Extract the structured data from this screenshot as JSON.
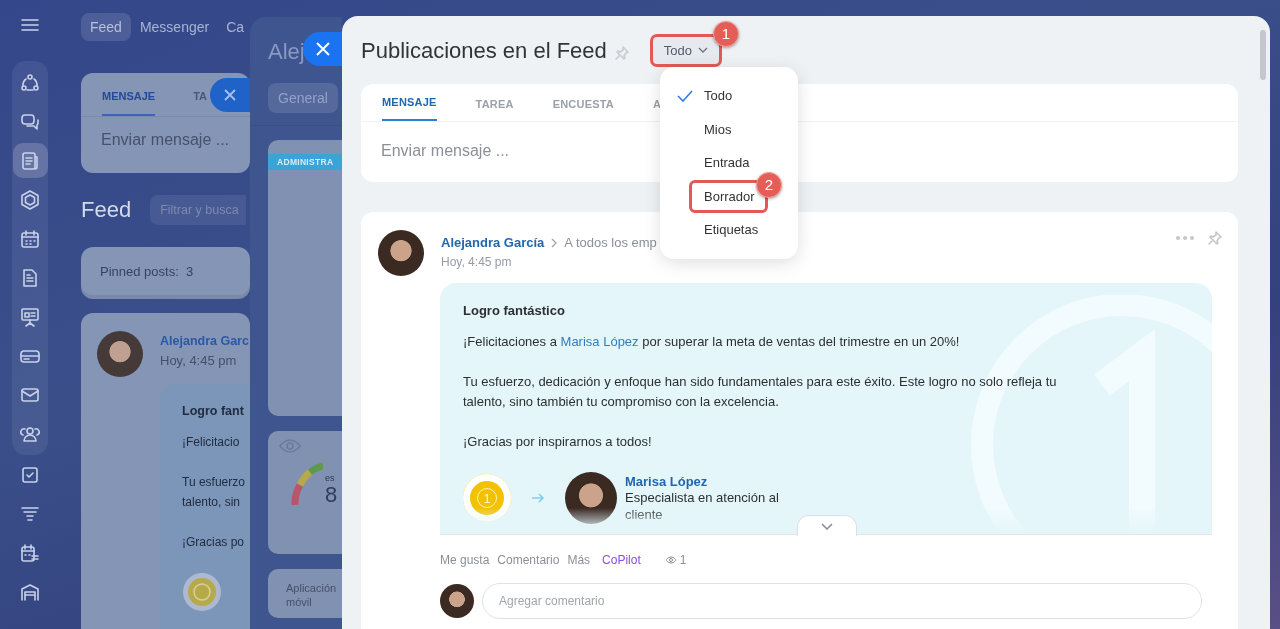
{
  "sidebar": {
    "items": [
      {
        "selected": false
      },
      {
        "selected": false
      },
      {
        "selected": true
      },
      {
        "selected": false
      },
      {
        "selected": false
      },
      {
        "selected": false
      },
      {
        "selected": false
      },
      {
        "selected": false
      },
      {
        "selected": false
      },
      {
        "selected": false
      },
      {
        "selected": false
      },
      {
        "selected": false
      },
      {
        "selected": false
      },
      {
        "selected": false
      }
    ]
  },
  "background": {
    "top_tabs": [
      {
        "label": "Feed",
        "selected": true
      },
      {
        "label": "Messenger",
        "selected": false
      },
      {
        "label": "Ca",
        "selected": false
      }
    ],
    "composer": {
      "tabs": [
        {
          "label": "MENSAJE",
          "selected": true
        },
        {
          "label": "TA",
          "selected": false
        }
      ],
      "placeholder": "Enviar mensaje ..."
    },
    "feed_title": "Feed",
    "filter_placeholder": "Filtrar y busca",
    "pinned": "Pinned posts:  3",
    "post": {
      "author": "Alejandra Garc",
      "time": "Hoy, 4:45 pm",
      "title": "Logro fant",
      "paragraphs": [
        [
          "¡Felicitacio"
        ],
        [
          "Tu esfuerzo",
          "talento, sin"
        ],
        [
          "¡Gracias po"
        ]
      ]
    }
  },
  "side_panel": {
    "title": "Alej",
    "tab": "General",
    "badge": "ADMINISTRA",
    "gauge_label": "es",
    "gauge_value": "8",
    "app_link": "Aplicación móvil"
  },
  "main": {
    "title": "Publicaciones en el Feed",
    "filter": {
      "label": "Todo",
      "callout": "1"
    },
    "menu": [
      {
        "label": "Todo",
        "selected": true
      },
      {
        "label": "Mios",
        "selected": false
      },
      {
        "label": "Entrada",
        "selected": false
      },
      {
        "label": "Borrador",
        "selected": false,
        "callout": "2"
      },
      {
        "label": "Etiquetas",
        "selected": false
      }
    ],
    "composer": {
      "tabs": [
        {
          "label": "MENSAJE",
          "selected": true
        },
        {
          "label": "TAREA",
          "selected": false
        },
        {
          "label": "ENCUESTA",
          "selected": false
        },
        {
          "label": "A",
          "selected": false
        }
      ],
      "placeholder": "Enviar mensaje ..."
    },
    "post": {
      "author": "Alejandra García",
      "audience": "A todos los emp",
      "time": "Hoy, 4:45 pm",
      "title": "Logro fantástico",
      "paragraphs": [
        [
          {
            "text": "¡Felicitaciones a "
          },
          {
            "text": "Marisa López",
            "kind": "link"
          },
          {
            "text": " por superar la meta de ventas del trimestre en un 20%!"
          }
        ],
        [
          {
            "text": "Tu esfuerzo, dedicación y enfoque han sido fundamentales para este éxito. Este logro no solo refleja tu talento, sino también tu compromiso con la excelencia."
          }
        ],
        [
          {
            "text": "¡Gracias por inspirarnos a todos!"
          }
        ]
      ],
      "badge_number": "1",
      "recipient": {
        "name": "Marisa López",
        "role": "Especialista en atención al cliente"
      },
      "actions": [
        {
          "label": "Me gusta",
          "kind": "plain"
        },
        {
          "label": "Comentario",
          "kind": "plain"
        },
        {
          "label": "Más",
          "kind": "plain"
        },
        {
          "label": "CoPilot",
          "kind": "accent"
        }
      ],
      "views": "1",
      "comment_placeholder": "Agregar comentario"
    }
  }
}
